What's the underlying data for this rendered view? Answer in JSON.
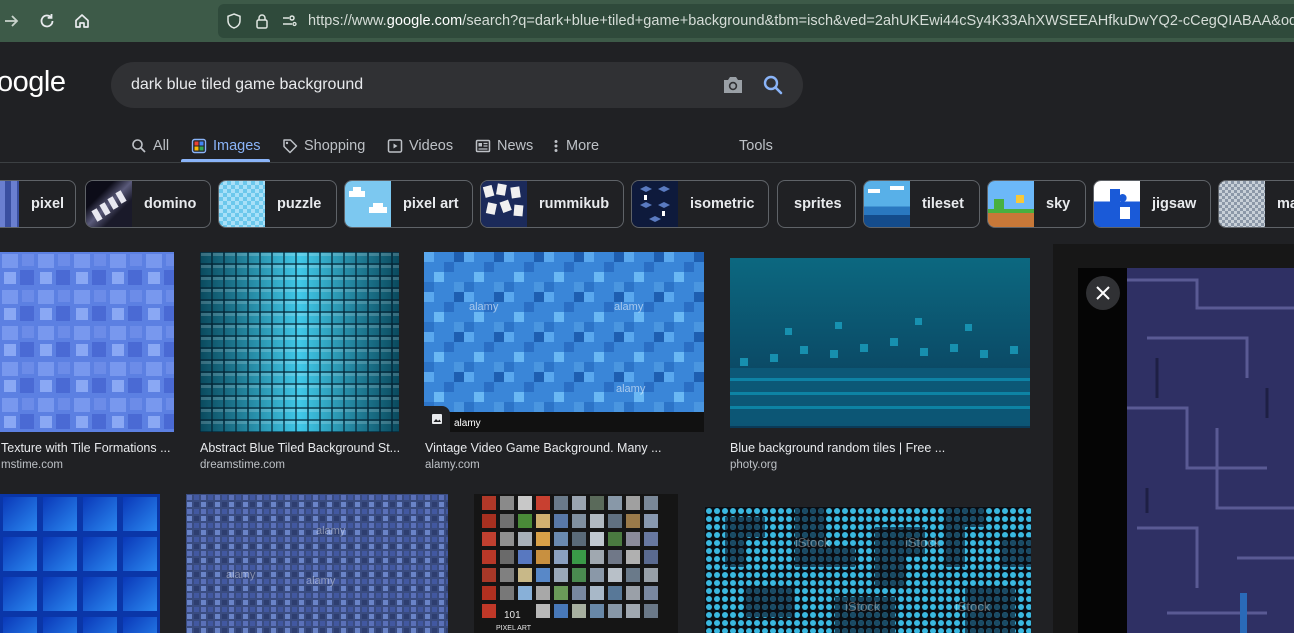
{
  "browser": {
    "url_prefix": "https://www.",
    "url_domain": "google.com",
    "url_rest": "/search?q=dark+blue+tiled+game+background&tbm=isch&ved=2ahUKEwi44cSy4K33AhXWSEEAHfkuDwYQ2-cCegQIABAA&oq=dark+"
  },
  "header": {
    "logo": "oogle",
    "search_value": "dark blue tiled game background"
  },
  "tabs": [
    {
      "label": "All",
      "icon": "search-icon"
    },
    {
      "label": "Images",
      "icon": "image-icon",
      "active": true
    },
    {
      "label": "Shopping",
      "icon": "tag-icon"
    },
    {
      "label": "Videos",
      "icon": "play-icon"
    },
    {
      "label": "News",
      "icon": "news-icon"
    },
    {
      "label": "More",
      "icon": "more-vert-icon"
    },
    {
      "label": "Tools",
      "icon": ""
    }
  ],
  "chips": [
    {
      "label": "pixel"
    },
    {
      "label": "domino"
    },
    {
      "label": "puzzle"
    },
    {
      "label": "pixel art"
    },
    {
      "label": "rummikub"
    },
    {
      "label": "isometric"
    },
    {
      "label": "sprites"
    },
    {
      "label": "tileset"
    },
    {
      "label": "sky"
    },
    {
      "label": "jigsaw"
    },
    {
      "label": "ma"
    }
  ],
  "results": [
    {
      "title": "Texture with Tile Formations ...",
      "source": "mstime.com"
    },
    {
      "title": "Abstract Blue Tiled Background St...",
      "source": "dreamstime.com"
    },
    {
      "title": "Vintage Video Game Background. Many ...",
      "source": "alamy.com"
    },
    {
      "title": "Blue background random tiles | Free ...",
      "source": "photy.org"
    }
  ],
  "watermarks": {
    "alamy": "alamy",
    "istock": "iStock",
    "pixel_art_101": "101",
    "pixel_art_label": "PIXEL ART"
  },
  "colors": {
    "accent": "#8ab4f8",
    "browser_bar": "#3d5a48",
    "page_bg": "#202124"
  }
}
